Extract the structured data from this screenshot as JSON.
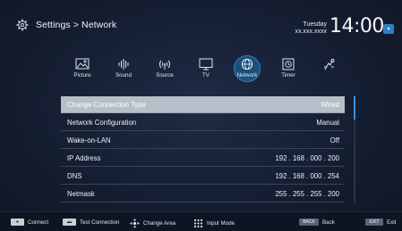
{
  "header": {
    "title": "Settings > Network",
    "day": "Tuesday",
    "date": "xx.xxx.xxxx",
    "time": "14:00",
    "menu_glyph": "▾"
  },
  "tabs": [
    {
      "label": "Picture",
      "icon": "picture-icon",
      "active": false
    },
    {
      "label": "Sound",
      "icon": "sound-icon",
      "active": false
    },
    {
      "label": "Source",
      "icon": "source-icon",
      "active": false
    },
    {
      "label": "TV",
      "icon": "tv-icon",
      "active": false
    },
    {
      "label": "Network",
      "icon": "network-icon",
      "active": true
    },
    {
      "label": "Timer",
      "icon": "timer-icon",
      "active": false
    },
    {
      "label": "",
      "icon": "system-icon",
      "active": false
    }
  ],
  "rows": [
    {
      "key": "Change Connection Type",
      "value": "Wired",
      "selected": true
    },
    {
      "key": "Network Configuration",
      "value": "Manual",
      "selected": false
    },
    {
      "key": "Wake-on-LAN",
      "value": "Off",
      "selected": false
    },
    {
      "key": "IP Address",
      "value": "192 . 168 . 000 . 200",
      "selected": false
    },
    {
      "key": "DNS",
      "value": "192 . 168 . 000 . 254",
      "selected": false
    },
    {
      "key": "Netmask",
      "value": "255 . 255 . 255 . 200",
      "selected": false
    }
  ],
  "footer": {
    "connect": "Connect",
    "test_connection": "Test Connection",
    "change_area": "Change Area",
    "input_mode": "Input Mode",
    "back_key": "BACK",
    "back": "Back",
    "exit_key": "EXIT",
    "exit": "Exit"
  },
  "colors": {
    "accent": "#3b92da",
    "selected_row": "#b6bfc8",
    "background": "#141d30"
  }
}
